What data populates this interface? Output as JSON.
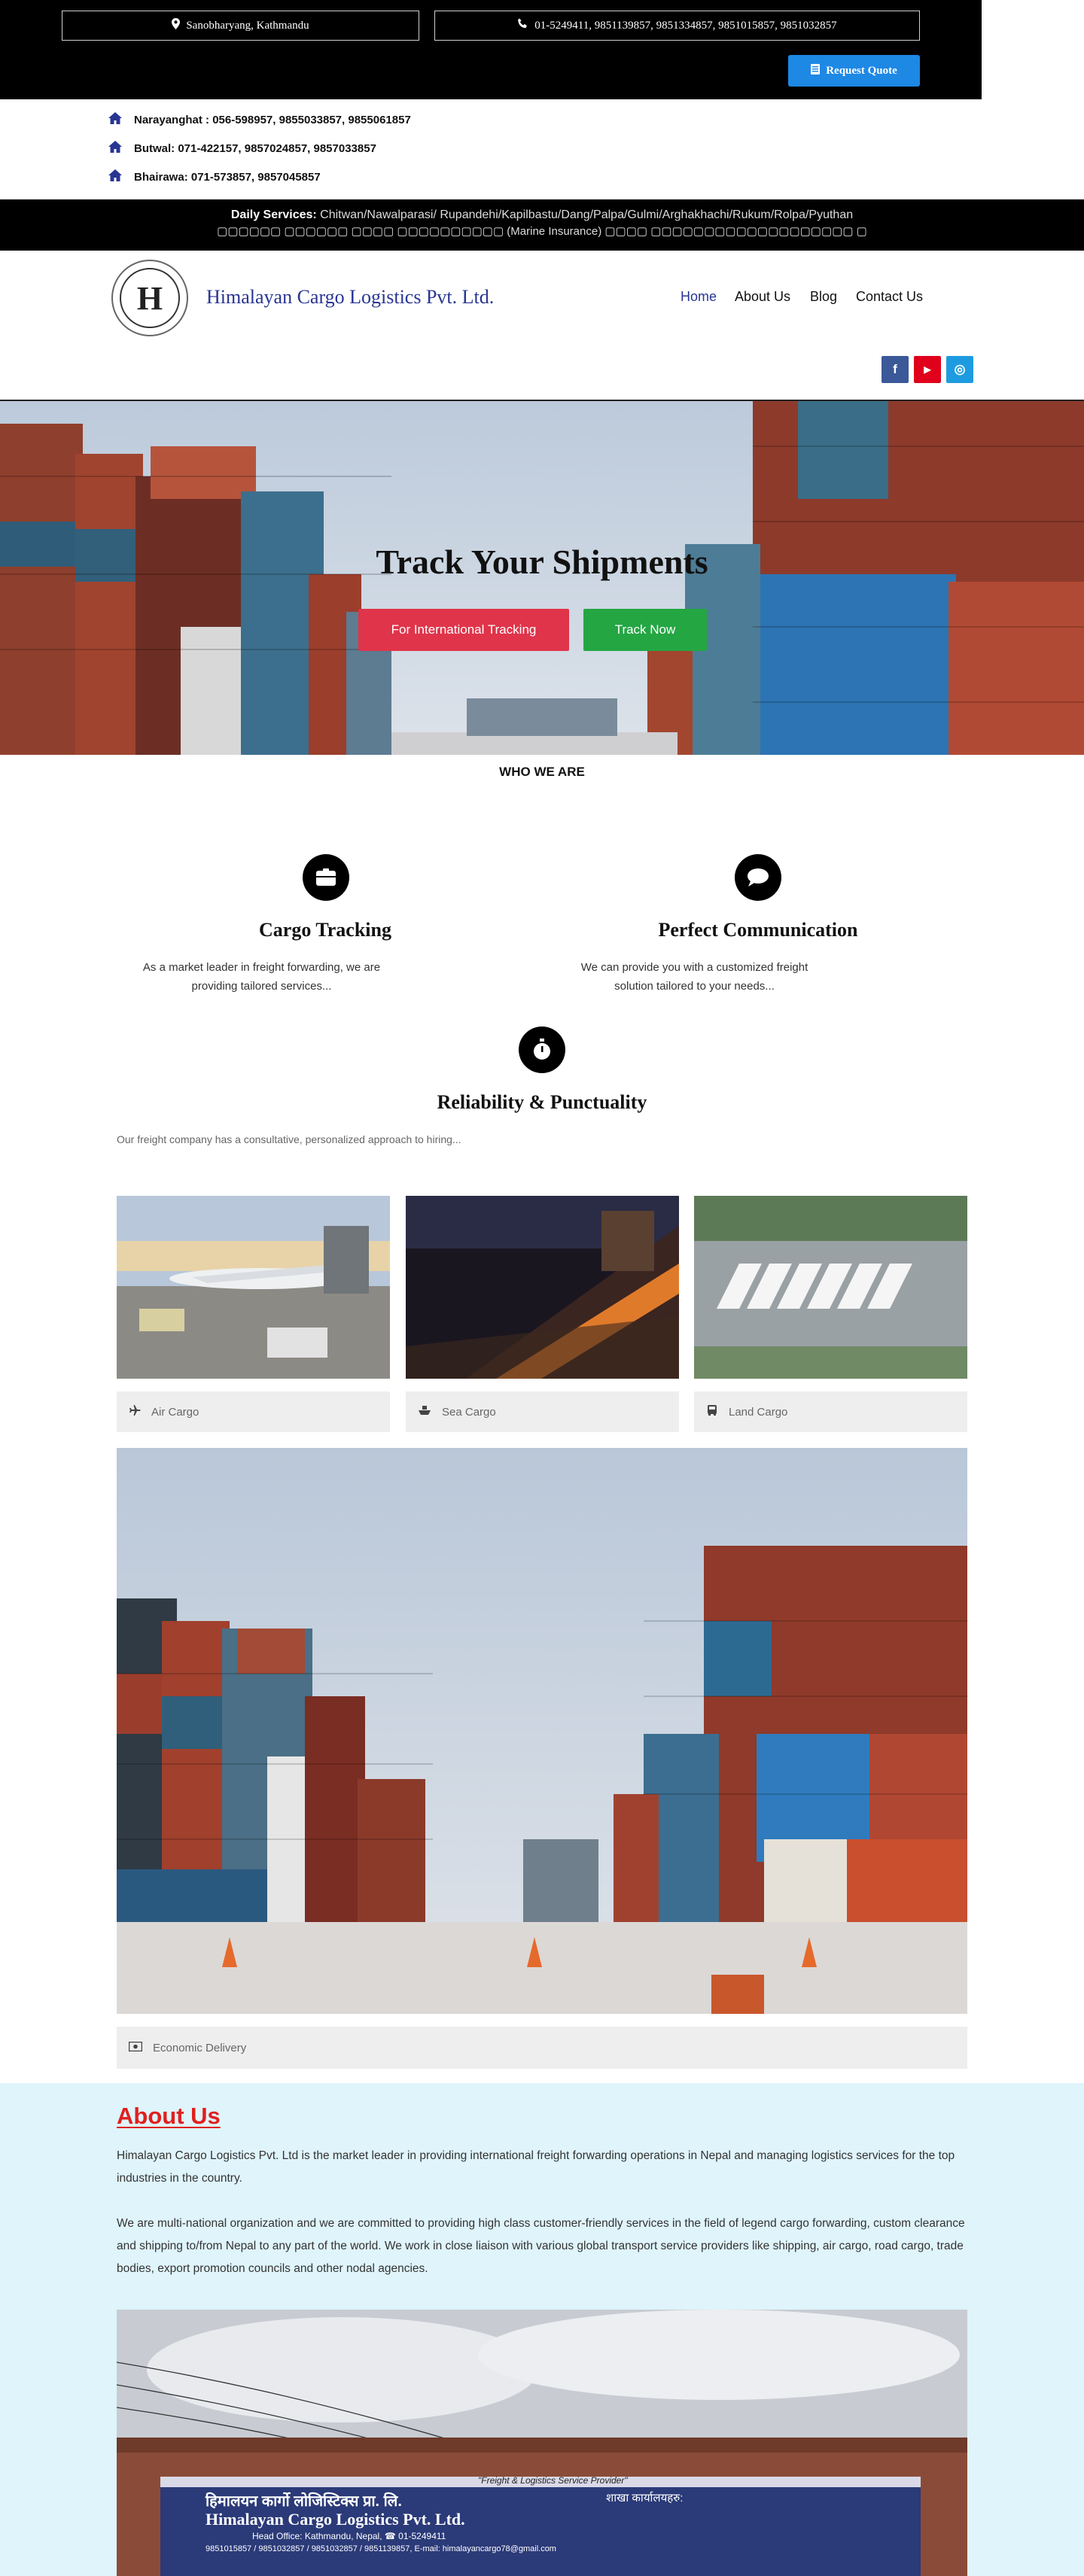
{
  "topbar": {
    "location": "Sanobharyang, Kathmandu",
    "phones": "01-5249411, 9851139857, 9851334857, 9851015857, 9851032857",
    "quote_button": "Request Quote",
    "location_icon": "map-marker-icon",
    "phone_icon": "phone-icon",
    "quote_icon": "document-icon"
  },
  "branches": [
    {
      "label": "Narayanghat : 056-598957, 9855033857, 9855061857"
    },
    {
      "label": "Butwal: 071-422157, 9857024857, 9857033857"
    },
    {
      "label": "Bhairawa: 071-573857, 9857045857"
    }
  ],
  "daily_services": {
    "heading": "Daily Services:",
    "routes": "Chitwan/Nawalparasi/ Rupandehi/Kapilbastu/Dang/Palpa/Gulmi/Arghakhachi/Rukum/Rolpa/Pyuthan",
    "insurance_line": "▢▢▢▢▢▢ ▢▢▢▢▢▢ ▢▢▢▢ ▢▢▢▢▢▢▢▢▢▢ (Marine Insurance) ▢▢▢▢ ▢▢▢▢▢▢▢▢▢▢▢▢▢▢▢▢▢▢▢ ▢"
  },
  "header": {
    "brand": "Himalayan Cargo Logistics Pvt. Ltd.",
    "logo_letter": "H",
    "nav": [
      {
        "label": "Home"
      },
      {
        "label": "About Us"
      },
      {
        "label": "Blog"
      },
      {
        "label": "Contact Us"
      }
    ],
    "social": [
      {
        "glyph": "f",
        "color": "#3b5998"
      },
      {
        "glyph": "▶",
        "color": "#e0001b"
      },
      {
        "glyph": "◎",
        "color": "#1e9be0"
      }
    ]
  },
  "hero": {
    "title": "Track Your Shipments",
    "international_button": "For International Tracking",
    "track_button": "Track Now"
  },
  "who_we_are": "WHO WE ARE",
  "features": [
    {
      "title": "Cargo Tracking",
      "desc_line1": "As a market leader in freight forwarding, we are",
      "desc_line2": "providing tailored services...",
      "icon": "box-icon"
    },
    {
      "title": "Perfect Communication",
      "desc_line1": "We can provide you with a customized freight",
      "desc_line2": "solution tailored to your needs...",
      "icon": "chat-bubble-icon"
    },
    {
      "title": "Reliability & Punctuality",
      "desc_line1": "Our freight company has a consultative, personalized approach to hiring...",
      "icon": "stopwatch-icon"
    }
  ],
  "services": [
    {
      "label": "Air Cargo",
      "icon": "plane-icon"
    },
    {
      "label": "Sea Cargo",
      "icon": "ship-icon"
    },
    {
      "label": "Land Cargo",
      "icon": "bus-icon"
    }
  ],
  "economic": {
    "label": "Economic Delivery",
    "icon": "money-icon"
  },
  "about": {
    "title": "About Us",
    "p1": "Himalayan Cargo Logistics Pvt. Ltd is the market leader in providing international freight forwarding operations in Nepal and managing logistics services for the top industries in the country.",
    "p2": "We are multi-national organization and we are committed to providing high class customer-friendly services in the field of legend cargo forwarding, custom clearance and shipping to/from Nepal to any part of the world. We work in close liaison with various global transport service providers like shipping, air cargo, road cargo, trade bodies, export promotion councils and other nodal agencies."
  },
  "office_sign": {
    "tagline": "\"Freight & Logistics Service Provider\"",
    "name_nepali": "हिमालयन कार्गो लोजिस्टिक्स प्रा. लि.",
    "name": "Himalayan Cargo Logistics Pvt. Ltd.",
    "head_office": "Head Office: Kathmandu, Nepal, ☎ 01-5249411",
    "contacts": "9851015857 / 9851032857 / 9851032857 / 9851139857, E-mail: himalayancargo78@gmail.com",
    "branches_nepali": "शाखा कार्यालयहरु:"
  }
}
